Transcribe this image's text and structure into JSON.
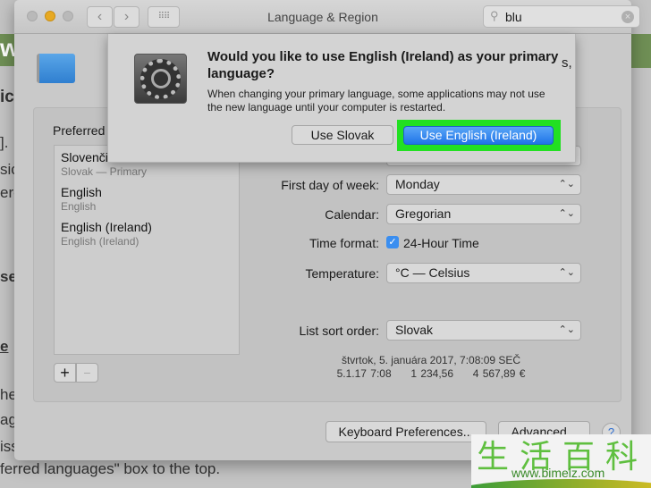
{
  "background_page": {
    "fragments": [
      "ic",
      "].",
      "sic",
      "ere",
      "sel",
      "e",
      "he",
      "ag",
      "iss"
    ],
    "right_fragment": "s,",
    "bottom_text": "ferred languages\" box to the top."
  },
  "window": {
    "title": "Language & Region",
    "back_icon": "chevron-left-icon",
    "forward_icon": "chevron-right-icon",
    "grid_icon": "grid-icon",
    "search": {
      "value": "blu",
      "icon": "search-icon",
      "clear_icon": "clear-icon"
    }
  },
  "dialog": {
    "icon": "system-preferences-gear-icon",
    "title": "Would you like to use English (Ireland) as your primary language?",
    "message": "When changing your primary language, some applications may not use the new language until your computer is restarted.",
    "secondary_button": "Use Slovak",
    "primary_button": "Use English (Ireland)",
    "highlight_color": "#22e022",
    "primary_color": "#2f86f0"
  },
  "preferred": {
    "label": "Preferred languages:",
    "items": [
      {
        "name": "Slovenčina",
        "sub": "Slovak — Primary"
      },
      {
        "name": "English",
        "sub": "English"
      },
      {
        "name": "English (Ireland)",
        "sub": "English (Ireland)"
      }
    ],
    "add": "+",
    "remove": "−"
  },
  "settings": {
    "first_day_label": "First day of week:",
    "first_day": "Monday",
    "calendar_label": "Calendar:",
    "calendar": "Gregorian",
    "time_format_label": "Time format:",
    "time_format_checked": true,
    "time_format": "24-Hour Time",
    "temperature_label": "Temperature:",
    "temperature": "°C — Celsius",
    "list_sort_label": "List sort order:",
    "list_sort": "Slovak",
    "sample_line1": "štvrtok, 5. januára 2017, 7:08:09 SEČ",
    "sample_date": "5.1.17 7:08",
    "sample_number": "1 234,56",
    "sample_currency": "4 567,89 €"
  },
  "footer": {
    "keyboard_button": "Keyboard Preferences...",
    "advanced_button": "Advanced...",
    "help": "?"
  },
  "watermark": {
    "chars": "生活百科",
    "url": "www.bimeiz.com"
  }
}
